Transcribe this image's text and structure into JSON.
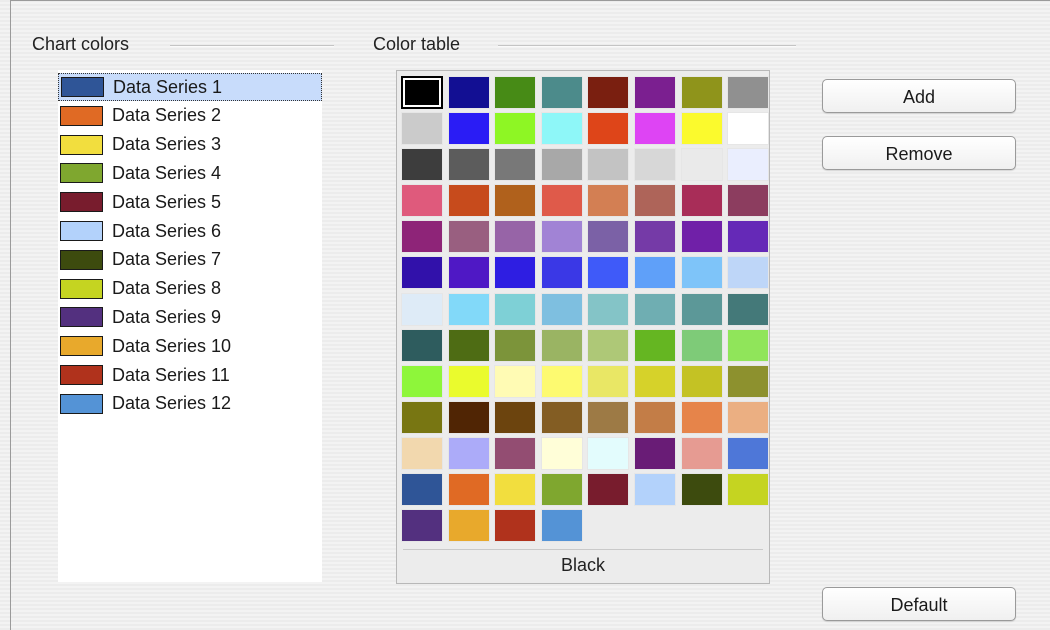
{
  "chart_colors": {
    "title": "Chart colors",
    "selected_index": 0,
    "series": [
      {
        "label": "Data Series 1",
        "color": "#2f5597"
      },
      {
        "label": "Data Series 2",
        "color": "#e06a24"
      },
      {
        "label": "Data Series 3",
        "color": "#f2de3e"
      },
      {
        "label": "Data Series 4",
        "color": "#7fa72f"
      },
      {
        "label": "Data Series 5",
        "color": "#781c2d"
      },
      {
        "label": "Data Series 6",
        "color": "#b3d2fb"
      },
      {
        "label": "Data Series 7",
        "color": "#3d4b0e"
      },
      {
        "label": "Data Series 8",
        "color": "#c5d421"
      },
      {
        "label": "Data Series 9",
        "color": "#53307f"
      },
      {
        "label": "Data Series 10",
        "color": "#e8a92c"
      },
      {
        "label": "Data Series 11",
        "color": "#b0321c"
      },
      {
        "label": "Data Series 12",
        "color": "#5493d6"
      }
    ]
  },
  "color_table": {
    "title": "Color table",
    "selected_index": 0,
    "selected_name": "Black",
    "colors": [
      "#000000",
      "#120f93",
      "#478b16",
      "#4c8b8b",
      "#7a1f10",
      "#7b1f90",
      "#8f941b",
      "#909090",
      "#cbcbcb",
      "#2a1cf5",
      "#8ef624",
      "#8ef7f8",
      "#de4519",
      "#de44f4",
      "#fbfa2d",
      "#ffffff",
      "#3d3d3d",
      "#5c5c5c",
      "#787878",
      "#a8a8a8",
      "#c3c3c3",
      "#d7d7d7",
      "#eaeaea",
      "#eaeefe",
      "#df5a7c",
      "#c74b1c",
      "#b0611c",
      "#df5a4a",
      "#d37f53",
      "#ae6459",
      "#a82d58",
      "#8c3d5f",
      "#8e2478",
      "#995f80",
      "#9764a7",
      "#a183d5",
      "#7b61a6",
      "#753aa7",
      "#7020a8",
      "#6529b7",
      "#3111aa",
      "#4f18c5",
      "#2e1ee2",
      "#3a38e6",
      "#3f5af9",
      "#5fa0f9",
      "#7ec4f9",
      "#bed6f8",
      "#deebf7",
      "#82d9f9",
      "#7ed0d6",
      "#7ebfe0",
      "#84c4c7",
      "#6faeb2",
      "#5c9898",
      "#447979",
      "#2e5c5e",
      "#4e6c14",
      "#7c943a",
      "#9ab463",
      "#aec877",
      "#65b622",
      "#7ecb78",
      "#90e55a",
      "#8ef63a",
      "#eafb2d",
      "#fffbb4",
      "#fdfa70",
      "#e9e765",
      "#d6d22a",
      "#c4c224",
      "#8d912e",
      "#787612",
      "#502504",
      "#6c440e",
      "#835d23",
      "#9d7a45",
      "#c37d47",
      "#e6844a",
      "#ebaf82",
      "#f2d8ae",
      "#acabf9",
      "#934d72",
      "#fffed8",
      "#e3fcfd",
      "#691c76",
      "#e69b92",
      "#4e77d8",
      "#2f5597",
      "#e06a24",
      "#f2de3e",
      "#7fa72f",
      "#781c2d",
      "#b3d2fb",
      "#3d4b0e",
      "#c5d421",
      "#53307f",
      "#e8a92c",
      "#b0321c",
      "#5493d6"
    ]
  },
  "buttons": {
    "add": "Add",
    "remove": "Remove",
    "default": "Default"
  }
}
